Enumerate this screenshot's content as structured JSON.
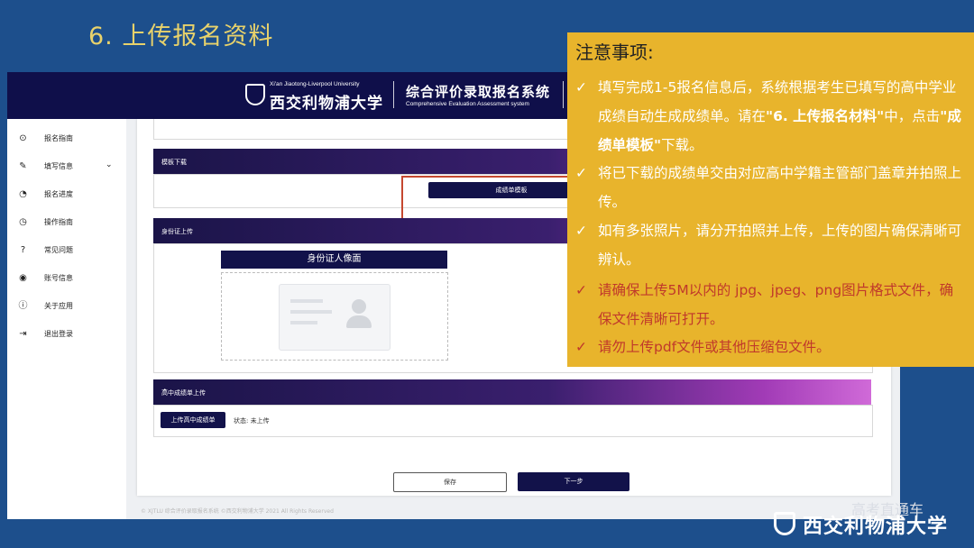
{
  "slide": {
    "title": "6. 上传报名资料"
  },
  "header": {
    "university_en": "Xi'an Jiaotong-Liverpool University",
    "university_cn": "西交利物浦大学",
    "system_cn": "综合评价录取报名系统",
    "system_en": "Comprehensive Evaluation Assessment system"
  },
  "sidebar": {
    "items": [
      {
        "label": "报名指南",
        "icon": "play-circle-icon"
      },
      {
        "label": "填写信息",
        "icon": "edit-icon"
      },
      {
        "label": "报名进度",
        "icon": "gauge-icon"
      },
      {
        "label": "操作指南",
        "icon": "guide-icon"
      },
      {
        "label": "常见问题",
        "icon": "question-icon"
      },
      {
        "label": "账号信息",
        "icon": "account-icon"
      },
      {
        "label": "关于应用",
        "icon": "info-icon"
      },
      {
        "label": "退出登录",
        "icon": "logout-icon"
      }
    ]
  },
  "main": {
    "template_section": {
      "title": "模板下载",
      "button": "成绩单模板"
    },
    "id_section": {
      "title": "身份证上传",
      "upload_label": "身份证人像面"
    },
    "transcript_section": {
      "title": "高中成绩单上传",
      "button": "上传高中成绩单",
      "status": "状态: 未上传"
    },
    "actions": {
      "save": "保存",
      "next": "下一步"
    },
    "footer": "© XJTLU 综合评价录取报名系统 ©西交利物浦大学 2021 All Rights Reserved"
  },
  "notice": {
    "title": "注意事项:",
    "items": [
      {
        "check": "✓",
        "text_before": "填写完成1-5报名信息后，系统根据考生已填写的高中学业成绩自动生成成绩单。请在",
        "highlight1": "\"6. 上传报名材料\"",
        "text_mid": "中，点击",
        "highlight2": "\"成绩单模板\"",
        "text_after": "下载。"
      },
      {
        "check": "✓",
        "text": "将已下载的成绩单交由对应高中学籍主管部门盖章并拍照上传。"
      },
      {
        "check": "✓",
        "text": "如有多张照片，请分开拍照并上传，上传的图片确保清晰可辨认。"
      },
      {
        "check": "✓",
        "text": "请确保上传5M以内的 jpg、jpeg、png图片格式文件，确保文件清晰可打开。"
      },
      {
        "check": "✓",
        "text": "请勿上传pdf文件或其他压缩包文件。"
      }
    ],
    "colors": {
      "background": "#e8b42c",
      "normal_text": "#ffffff",
      "warning_text": "#c0392b"
    }
  },
  "watermark": {
    "text": "高考直通车",
    "logo": "西交利物浦大学"
  }
}
